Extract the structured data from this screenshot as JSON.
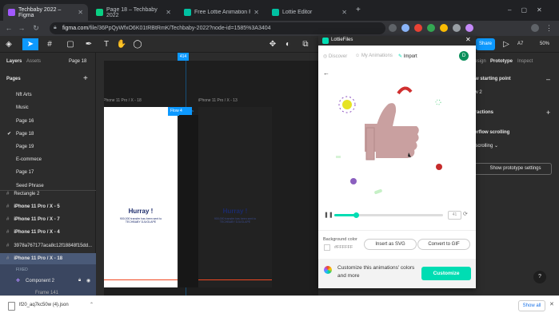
{
  "browser": {
    "tabs": [
      {
        "label": "Techbaby 2022 – Figma",
        "fav_color": "#a259ff"
      },
      {
        "label": "Page 18 – Techbaby 2022",
        "fav_color": "#0acf83"
      },
      {
        "label": "Free Lottie Animation Files, Tools",
        "fav_color": "#00c1a2"
      },
      {
        "label": "Lottie Editor",
        "fav_color": "#00c1a2"
      }
    ],
    "new_tab": "+",
    "url_domain": "figma.com",
    "url_path": "/file/36PpQyWfxO6K01tRBtRmK/Techbaby-2022?node-id=1585%3A3404"
  },
  "figma": {
    "toolbar": {
      "share": "Share",
      "zoom": "50%",
      "user_initials": "A7"
    },
    "left_tabs": {
      "layers": "Layers",
      "assets": "Assets",
      "page": "Page 18"
    },
    "pages_header": "Pages",
    "pages": [
      "Nft Arts",
      "Music",
      "Page 16",
      "Page 18",
      "Page 19",
      "E-commece",
      "Page 17",
      "Seed Phrase"
    ],
    "current_page": "Page 18",
    "layers": [
      "Rectangle 2",
      "iPhone 11 Pro / X - 5",
      "iPhone 11 Pro / X - 7",
      "iPhone 11 Pro / X - 4",
      "3978a767177aca8c12f18848f15dd...",
      "iPhone 11 Pro / X - 18"
    ],
    "fixed_label": "FIXED",
    "component": "Component 2",
    "sub_item": "Frame 141",
    "ruler_mark": "414",
    "frame_labels": [
      "iPhone 11 Pro / X - 18",
      "iPhone 11 Pro / X - 13"
    ],
    "flow_label": "Flow 4",
    "hurray": "Hurray !",
    "hurray_sub": "900,000 transfer has been sent to TECHBABY DJUOLAPE",
    "right": {
      "tabs": [
        "Design",
        "Prototype",
        "Inspect"
      ],
      "flow_start": "Flow starting point",
      "flow_item": "Flow 2",
      "interactions": "Interactions",
      "overflow": "Overflow scrolling",
      "scrolling": "No scrolling",
      "show_settings": "Show prototype settings"
    },
    "help": "?"
  },
  "lottie": {
    "brand": "LottieFiles",
    "nav": {
      "discover": "Discover",
      "my_animations": "My Animations",
      "import": "Import"
    },
    "avatar": "D",
    "bg_color_label": "Background color",
    "bg_color_value": "#FFFFFF",
    "insert_svg": "Insert as SVG",
    "convert_gif": "Convert to GIF",
    "customize_text": "Customize this animations' colors and more",
    "customize_btn": "Customize",
    "progress": 0.2,
    "frame_box": "41"
  },
  "download": {
    "file": "lf20_aq7kc50w (4).json",
    "show_all": "Show all"
  },
  "colors": {
    "accent": "#0d99ff",
    "lottie_green": "#00ddb3",
    "thumb": "#c9a0a0"
  }
}
